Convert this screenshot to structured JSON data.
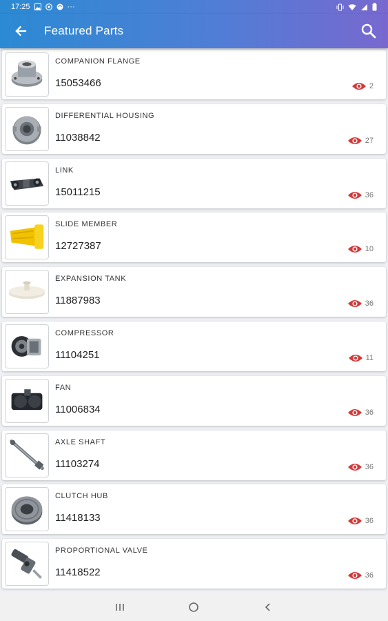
{
  "status_bar": {
    "time": "17:25",
    "overflow": "···",
    "left_icons": [
      "image-icon",
      "whatsapp-icon",
      "sync-icon"
    ],
    "right_icons": [
      "vibrate-icon",
      "wifi-icon",
      "signal-icon",
      "battery-icon"
    ]
  },
  "app_bar": {
    "title": "Featured Parts",
    "back_icon": "arrow-left-icon",
    "search_icon": "search-icon",
    "gradient": [
      "#2b8ad3",
      "#4f7ed6",
      "#7868cf"
    ]
  },
  "view_icon_color": "#d23a3a",
  "parts": [
    {
      "name": "COMPANION FLANGE",
      "number": "15053466",
      "views": "2",
      "image": "flange"
    },
    {
      "name": "DIFFERENTIAL HOUSING",
      "number": "11038842",
      "views": "27",
      "image": "housing"
    },
    {
      "name": "LINK",
      "number": "15011215",
      "views": "36",
      "image": "link"
    },
    {
      "name": "SLIDE MEMBER",
      "number": "12727387",
      "views": "10",
      "image": "slide"
    },
    {
      "name": "EXPANSION TANK",
      "number": "11887983",
      "views": "36",
      "image": "tank"
    },
    {
      "name": "COMPRESSOR",
      "number": "11104251",
      "views": "11",
      "image": "compressor"
    },
    {
      "name": "FAN",
      "number": "11006834",
      "views": "36",
      "image": "fan"
    },
    {
      "name": "AXLE SHAFT",
      "number": "11103274",
      "views": "36",
      "image": "shaft"
    },
    {
      "name": "CLUTCH HUB",
      "number": "11418133",
      "views": "36",
      "image": "hub"
    },
    {
      "name": "PROPORTIONAL VALVE",
      "number": "11418522",
      "views": "36",
      "image": "valve"
    }
  ],
  "nav_bar": {
    "buttons": [
      "recent-apps-icon",
      "home-icon",
      "back-icon"
    ]
  }
}
